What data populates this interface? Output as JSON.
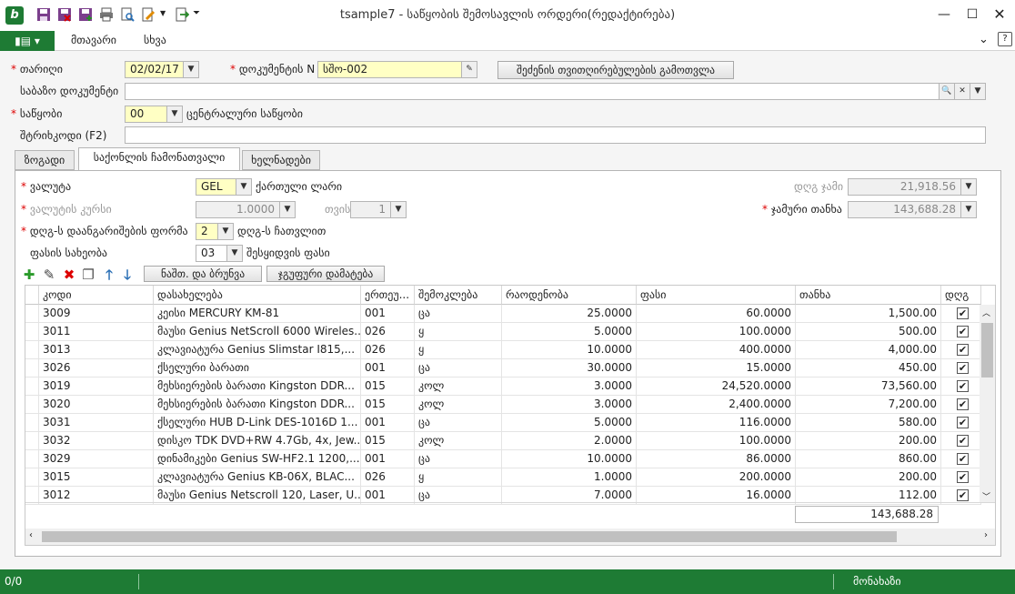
{
  "window": {
    "title": "tsample7 - საწყობის შემოსავლის ორდერი(რედაქტირება)"
  },
  "ribbon": {
    "file_icon": "sidebar-menu-icon",
    "tabs": [
      "მთავარი",
      "სხვა"
    ]
  },
  "header": {
    "date_label": "თარიღი",
    "date_value": "02/02/17",
    "docnum_label": "დოკუმენტის N",
    "docnum_value": "სშო-002",
    "calc_button": "შეძენის თვითღირებულების გამოთვლა",
    "base_doc_label": "საბაზო დოკუმენტი",
    "base_doc_value": "",
    "warehouse_label": "საწყობი",
    "warehouse_code": "00",
    "warehouse_name": "ცენტრალური საწყობი",
    "barcode_label": "შტრიხკოდი (F2)",
    "barcode_value": ""
  },
  "tabs": [
    "ზოგადი",
    "საქონლის ჩამონათვალი",
    "ხელნადები"
  ],
  "goods": {
    "currency_label": "ვალუტა",
    "currency_value": "GEL",
    "currency_name": "ქართული ლარი",
    "rate_label": "ვალუტის კურსი",
    "rate_value": "1.0000",
    "unit_label": "თვის",
    "unit_value": "1",
    "vat_form_label": "დღგ-ს დაანგარიშების ფორმა",
    "vat_form_value": "2",
    "vat_form_name": "დღგ-ს ჩათვლით",
    "price_type_label": "ფასის სახეობა",
    "price_type_value": "03",
    "price_type_name": "შესყიდვის ფასი",
    "vat_sum_label": "დღგ ჯამი",
    "vat_sum_value": "21,918.56",
    "total_label": "ჯამური თანხა",
    "total_value": "143,688.28",
    "toolbar": {
      "return_button": "ნაშთ. და ბრუნვა",
      "group_add_button": "ჯგუფური დამატება"
    }
  },
  "table": {
    "columns": [
      "კოდი",
      "დასახელება",
      "ერთეუ...",
      "შემოკლება",
      "რაოდენობა",
      "ფასი",
      "თანხა",
      "დღგ"
    ],
    "rows": [
      {
        "code": "3009",
        "name": "კეისი MERCURY KM-81",
        "unit": "001",
        "short": "ცა",
        "qty": "25.0000",
        "price": "60.0000",
        "amount": "1,500.00"
      },
      {
        "code": "3011",
        "name": "მაუსი Genius NetScroll 6000 Wireles...",
        "unit": "026",
        "short": "ყ",
        "qty": "5.0000",
        "price": "100.0000",
        "amount": "500.00"
      },
      {
        "code": "3013",
        "name": "კლავიატურა Genius Slimstar I815,...",
        "unit": "026",
        "short": "ყ",
        "qty": "10.0000",
        "price": "400.0000",
        "amount": "4,000.00"
      },
      {
        "code": "3026",
        "name": "ქსელური ბარათი",
        "unit": "001",
        "short": "ცა",
        "qty": "30.0000",
        "price": "15.0000",
        "amount": "450.00"
      },
      {
        "code": "3019",
        "name": "მეხსიერების ბარათი Kingston DDR...",
        "unit": "015",
        "short": "კოლ",
        "qty": "3.0000",
        "price": "24,520.0000",
        "amount": "73,560.00"
      },
      {
        "code": "3020",
        "name": "მეხსიერების ბარათი Kingston DDR...",
        "unit": "015",
        "short": "კოლ",
        "qty": "3.0000",
        "price": "2,400.0000",
        "amount": "7,200.00"
      },
      {
        "code": "3031",
        "name": "ქსელური HUB D-Link DES-1016D 1...",
        "unit": "001",
        "short": "ცა",
        "qty": "5.0000",
        "price": "116.0000",
        "amount": "580.00"
      },
      {
        "code": "3032",
        "name": "დისკო TDK DVD+RW 4.7Gb, 4x, Jew...",
        "unit": "015",
        "short": "კოლ",
        "qty": "2.0000",
        "price": "100.0000",
        "amount": "200.00"
      },
      {
        "code": "3029",
        "name": "დინამიკები Genius SW-HF2.1 1200,...",
        "unit": "001",
        "short": "ცა",
        "qty": "10.0000",
        "price": "86.0000",
        "amount": "860.00"
      },
      {
        "code": "3015",
        "name": "კლავიატურა Genius KB-06X, BLAC...",
        "unit": "026",
        "short": "ყ",
        "qty": "1.0000",
        "price": "200.0000",
        "amount": "200.00"
      },
      {
        "code": "3012",
        "name": "მაუსი Genius Netscroll 120, Laser, U...",
        "unit": "001",
        "short": "ცა",
        "qty": "7.0000",
        "price": "16.0000",
        "amount": "112.00"
      }
    ],
    "footer_total": "143,688.28"
  },
  "status": {
    "left": "0/0",
    "right": "მონახაზი"
  },
  "colors": {
    "accent": "#1e7b34",
    "required": "#d00000",
    "highlight": "#ffffc4"
  }
}
